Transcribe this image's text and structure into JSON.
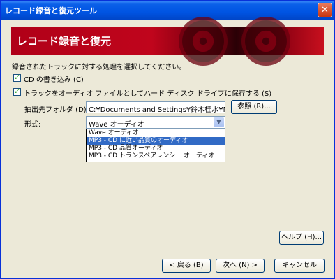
{
  "window": {
    "title": "レコード録音と復元ツール",
    "close_glyph": "✕"
  },
  "banner": {
    "title": "レコード録音と復元"
  },
  "instruction": "録音されたトラックに対する処理を選択してください。",
  "options": {
    "write_cd": {
      "label": "CD の書き込み (C)",
      "checked": true
    },
    "save_hd": {
      "label": "トラックをオーディオ ファイルとしてハード ディスク ドライブに保存する (S)",
      "checked": true
    }
  },
  "destination": {
    "label": "抽出先フォルダ (D):",
    "value": "C:¥Documents and Settings¥鈴木桂水¥M",
    "browse_label": "参照 (R)..."
  },
  "format": {
    "label": "形式:",
    "selected": "Wave オーディオ",
    "items": [
      "Wave オーディオ",
      "MP3 - CD に近い品質のオーディオ",
      "MP3 - CD 品質オーディオ",
      "MP3 - CD トランスペアレンシー オーディオ"
    ],
    "highlighted_index": 1
  },
  "buttons": {
    "help": "ヘルプ (H)...",
    "back": "< 戻る (B)",
    "next": "次へ (N) >",
    "cancel": "キャンセル"
  },
  "colors": {
    "titlebar": "#0054e3",
    "banner": "#c0051c",
    "selection": "#316ac5",
    "dialog_bg": "#ece9d8"
  }
}
